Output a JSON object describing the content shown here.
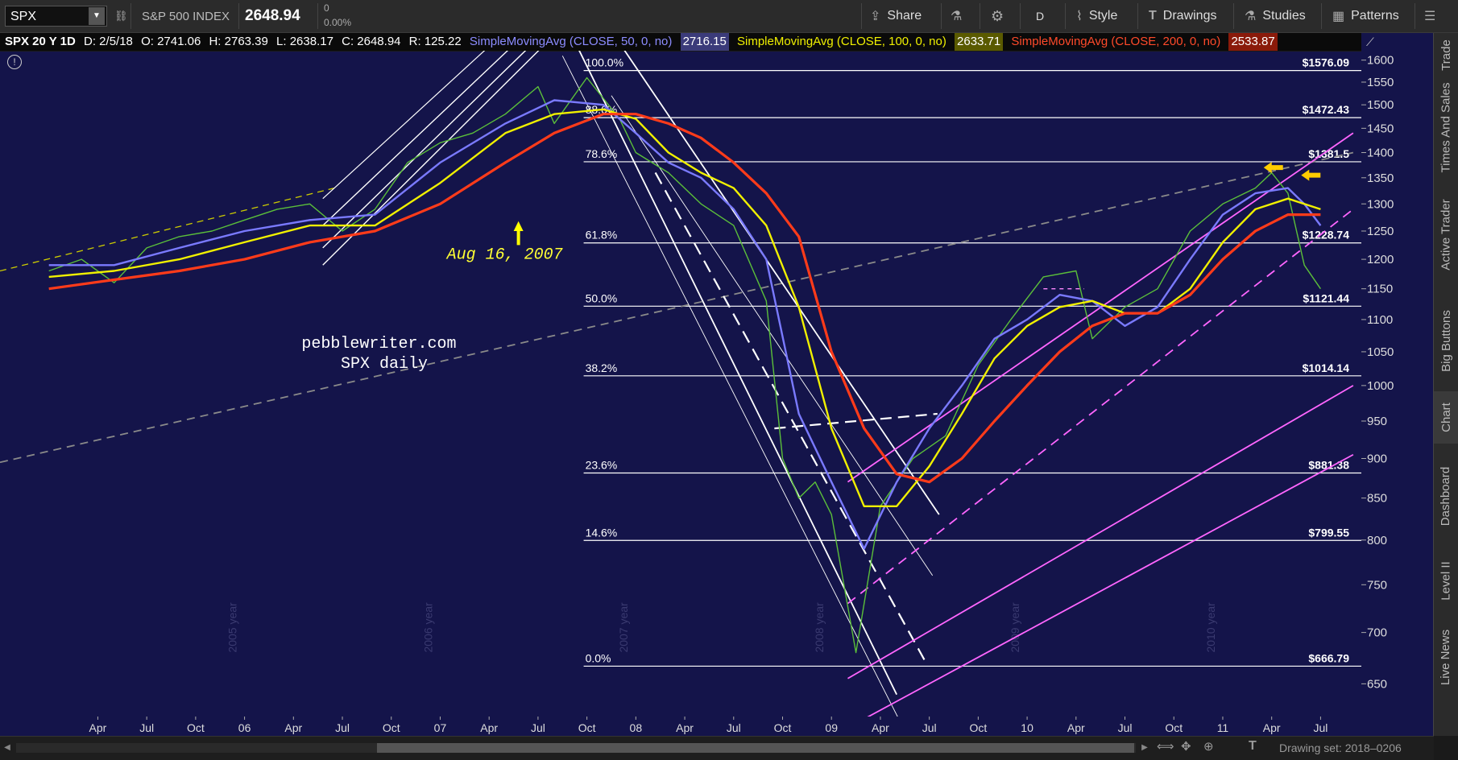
{
  "toolbar": {
    "symbol": "SPX",
    "name": "S&P 500 INDEX",
    "last": "2648.94",
    "change": "0",
    "change_pct": "0.00%",
    "buttons": {
      "share": "Share",
      "period": "D",
      "style": "Style",
      "drawings": "Drawings",
      "studies": "Studies",
      "patterns": "Patterns"
    }
  },
  "infobar": {
    "title": "SPX 20 Y 1D",
    "date": "D: 2/5/18",
    "open": "O: 2741.06",
    "high": "H: 2763.39",
    "low": "L: 2638.17",
    "close": "C: 2648.94",
    "range": "R: 125.22",
    "sma50": "SimpleMovingAvg (CLOSE, 50, 0, no)",
    "sma50_val": "2716.15",
    "sma100": "SimpleMovingAvg (CLOSE, 100, 0, no)",
    "sma100_val": "2633.71",
    "sma200": "SimpleMovingAvg (CLOSE, 200, 0, no)",
    "sma200_val": "2533.87"
  },
  "side_tabs": [
    "Trade",
    "Times And Sales",
    "Active Trader",
    "Big Buttons",
    "Chart",
    "Dashboard",
    "Level II",
    "Live News"
  ],
  "bottom": {
    "drawing_set": "Drawing set: 2018–0206"
  },
  "annotations": {
    "date_label": "Aug 16, 2007",
    "site": "pebblewriter.com",
    "desc": "SPX daily"
  },
  "colors": {
    "bg": "#14144a",
    "sma50": "#7a7aff",
    "sma100": "#f0f000",
    "sma200": "#ff3b1a",
    "magenta": "#ff66ff",
    "fib": "#ffffff"
  },
  "chart_data": {
    "type": "line",
    "title": "SPX 20 Y 1D",
    "ylim": [
      620,
      1620
    ],
    "y_ticks": [
      650,
      700,
      750,
      800,
      850,
      900,
      950,
      1000,
      1050,
      1100,
      1150,
      1200,
      1250,
      1300,
      1350,
      1400,
      1450,
      1500,
      1550,
      1600
    ],
    "x_ticks": [
      "Apr",
      "Jul",
      "Oct",
      "06",
      "Apr",
      "Jul",
      "Oct",
      "07",
      "Apr",
      "Jul",
      "Oct",
      "08",
      "Apr",
      "Jul",
      "Oct",
      "09",
      "Apr",
      "Jul",
      "Oct",
      "10",
      "Apr",
      "Jul",
      "Oct",
      "11",
      "Apr",
      "Jul"
    ],
    "x_tick_months": [
      3,
      6,
      9,
      12,
      15,
      18,
      21,
      24,
      27,
      30,
      33,
      36,
      39,
      42,
      45,
      48,
      51,
      54,
      57,
      60,
      63,
      66,
      69,
      72,
      75,
      78
    ],
    "year_watermarks": [
      "2005 year",
      "2006 year",
      "2007 year",
      "2008 year",
      "2009 year",
      "2010 year"
    ],
    "fib_levels": [
      {
        "pct": "100.0%",
        "price": "$1576.09",
        "value": 1576.09
      },
      {
        "pct": "88.6%",
        "price": "$1472.43",
        "value": 1472.43
      },
      {
        "pct": "78.6%",
        "price": "$1381.5",
        "value": 1381.5
      },
      {
        "pct": "61.8%",
        "price": "$1228.74",
        "value": 1228.74
      },
      {
        "pct": "50.0%",
        "price": "$1121.44",
        "value": 1121.44
      },
      {
        "pct": "38.2%",
        "price": "$1014.14",
        "value": 1014.14
      },
      {
        "pct": "23.6%",
        "price": "$881.38",
        "value": 881.38
      },
      {
        "pct": "14.6%",
        "price": "$799.55",
        "value": 799.55
      },
      {
        "pct": "0.0%",
        "price": "$666.79",
        "value": 666.79
      }
    ],
    "series": [
      {
        "name": "SPX",
        "color": "#5bbf3a",
        "x": [
          0,
          2,
          4,
          6,
          8,
          10,
          12,
          14,
          16,
          18,
          20,
          22,
          24,
          26,
          28,
          30,
          31,
          33,
          35,
          36,
          38,
          40,
          42,
          44,
          45,
          46,
          47,
          48,
          49.5,
          51,
          53,
          55,
          57,
          59,
          61,
          63,
          64,
          66,
          68,
          70,
          72,
          74,
          75,
          76,
          77,
          78
        ],
        "values": [
          1180,
          1200,
          1160,
          1220,
          1240,
          1250,
          1270,
          1290,
          1300,
          1250,
          1290,
          1380,
          1420,
          1440,
          1480,
          1540,
          1460,
          1560,
          1470,
          1400,
          1360,
          1300,
          1260,
          1130,
          900,
          850,
          870,
          830,
          680,
          840,
          900,
          930,
          1030,
          1100,
          1170,
          1180,
          1070,
          1120,
          1150,
          1250,
          1300,
          1330,
          1360,
          1320,
          1190,
          1150
        ]
      },
      {
        "name": "SimpleMovingAvg (CLOSE, 50, 0, no)",
        "color": "#7a7aff",
        "x": [
          0,
          4,
          8,
          12,
          16,
          20,
          24,
          28,
          31,
          34,
          36,
          38,
          40,
          42,
          44,
          46,
          48,
          50,
          52,
          54,
          56,
          58,
          60,
          62,
          64,
          66,
          68,
          70,
          72,
          74,
          76,
          77,
          78
        ],
        "values": [
          1190,
          1190,
          1220,
          1250,
          1270,
          1280,
          1380,
          1460,
          1510,
          1500,
          1440,
          1380,
          1350,
          1290,
          1200,
          960,
          870,
          790,
          870,
          940,
          1000,
          1070,
          1100,
          1140,
          1130,
          1090,
          1120,
          1200,
          1280,
          1320,
          1330,
          1300,
          1260
        ]
      },
      {
        "name": "SimpleMovingAvg (CLOSE, 100, 0, no)",
        "color": "#f0f000",
        "x": [
          0,
          4,
          8,
          12,
          16,
          20,
          24,
          28,
          31,
          34,
          36,
          38,
          40,
          42,
          44,
          46,
          48,
          50,
          52,
          54,
          56,
          58,
          60,
          62,
          64,
          66,
          68,
          70,
          72,
          74,
          76,
          78
        ],
        "values": [
          1170,
          1180,
          1200,
          1230,
          1260,
          1260,
          1340,
          1440,
          1480,
          1490,
          1470,
          1400,
          1360,
          1330,
          1260,
          1120,
          940,
          840,
          840,
          890,
          960,
          1040,
          1090,
          1120,
          1130,
          1110,
          1110,
          1150,
          1230,
          1290,
          1310,
          1290
        ]
      },
      {
        "name": "SimpleMovingAvg (CLOSE, 200, 0, no)",
        "color": "#ff3b1a",
        "x": [
          0,
          4,
          8,
          12,
          16,
          20,
          24,
          28,
          31,
          34,
          36,
          38,
          40,
          42,
          44,
          46,
          48,
          50,
          52,
          54,
          56,
          58,
          60,
          62,
          64,
          66,
          68,
          70,
          72,
          74,
          76,
          78
        ],
        "values": [
          1150,
          1165,
          1180,
          1200,
          1230,
          1250,
          1300,
          1380,
          1440,
          1480,
          1480,
          1460,
          1430,
          1380,
          1320,
          1240,
          1050,
          940,
          880,
          870,
          900,
          950,
          1000,
          1050,
          1090,
          1110,
          1110,
          1140,
          1200,
          1250,
          1280,
          1280
        ]
      }
    ]
  }
}
